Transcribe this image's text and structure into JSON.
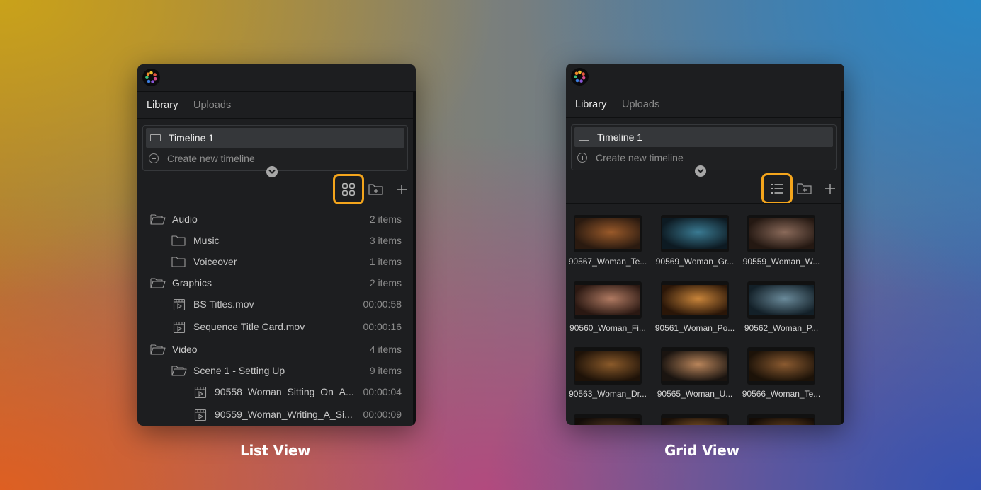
{
  "list_panel": {
    "tabs": [
      {
        "label": "Library",
        "active": true
      },
      {
        "label": "Uploads",
        "active": false
      }
    ],
    "timeline": {
      "name": "Timeline 1",
      "create_label": "Create new timeline"
    },
    "toolbar": {
      "view_toggle_icon": "grid-view-icon",
      "accent": "#f4a51c"
    },
    "tree": [
      {
        "type": "folder-open",
        "depth": 0,
        "name": "Audio",
        "meta": "2 items"
      },
      {
        "type": "folder",
        "depth": 1,
        "name": "Music",
        "meta": "3 items"
      },
      {
        "type": "folder",
        "depth": 1,
        "name": "Voiceover",
        "meta": "1 items"
      },
      {
        "type": "folder-open",
        "depth": 0,
        "name": "Graphics",
        "meta": "2 items"
      },
      {
        "type": "video",
        "depth": 1,
        "name": "BS Titles.mov",
        "meta": "00:00:58"
      },
      {
        "type": "video",
        "depth": 1,
        "name": "Sequence Title Card.mov",
        "meta": "00:00:16"
      },
      {
        "type": "folder-open",
        "depth": 0,
        "name": "Video",
        "meta": "4 items"
      },
      {
        "type": "folder-open",
        "depth": 1,
        "name": "Scene 1 - Setting Up",
        "meta": "9 items"
      },
      {
        "type": "video",
        "depth": 2,
        "name": "90558_Woman_Sitting_On_A...",
        "meta": "00:00:04"
      },
      {
        "type": "video",
        "depth": 2,
        "name": "90559_Woman_Writing_A_Si...",
        "meta": "00:00:09"
      }
    ]
  },
  "grid_panel": {
    "tabs": [
      {
        "label": "Library",
        "active": true
      },
      {
        "label": "Uploads",
        "active": false
      }
    ],
    "timeline": {
      "name": "Timeline 1",
      "create_label": "Create new timeline"
    },
    "toolbar": {
      "view_toggle_icon": "list-view-icon",
      "accent": "#f4a51c"
    },
    "clips": [
      {
        "label": "90567_Woman_Te...",
        "tone": [
          "#2a1a10",
          "#9a5a2a"
        ]
      },
      {
        "label": "90569_Woman_Gr...",
        "tone": [
          "#0d1a22",
          "#3a7a92"
        ]
      },
      {
        "label": "90559_Woman_W...",
        "tone": [
          "#241812",
          "#8a6a5a"
        ]
      },
      {
        "label": "90560_Woman_Fi...",
        "tone": [
          "#2a1812",
          "#b07a62"
        ]
      },
      {
        "label": "90561_Woman_Po...",
        "tone": [
          "#2a1608",
          "#c8843a"
        ]
      },
      {
        "label": "90562_Woman_P...",
        "tone": [
          "#132028",
          "#6a8a9a"
        ]
      },
      {
        "label": "90563_Woman_Dr...",
        "tone": [
          "#1e1208",
          "#8a5a2a"
        ]
      },
      {
        "label": "90565_Woman_U...",
        "tone": [
          "#1a1410",
          "#b8845a"
        ]
      },
      {
        "label": "90566_Woman_Te...",
        "tone": [
          "#1c1208",
          "#8a5a30"
        ]
      },
      {
        "label": "",
        "tone": [
          "#120c08",
          "#5a3a22"
        ]
      },
      {
        "label": "",
        "tone": [
          "#1a1008",
          "#8a5a2a"
        ]
      },
      {
        "label": "",
        "tone": [
          "#140c06",
          "#6a4420"
        ]
      }
    ]
  },
  "captions": {
    "list": "List View",
    "grid": "Grid View"
  }
}
